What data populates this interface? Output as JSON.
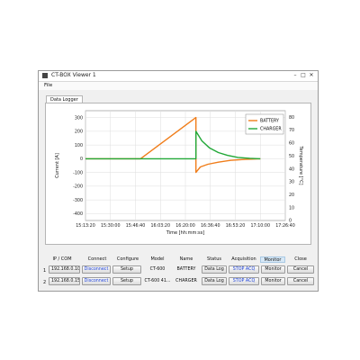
{
  "window": {
    "title": "CT-BOX Viewer 1",
    "controls": {
      "minimize": "–",
      "maximize": "□",
      "close": "✕"
    }
  },
  "menu": {
    "file": "File"
  },
  "tabs": [
    {
      "label": "Data Logger",
      "active": true
    }
  ],
  "chart_data": {
    "type": "line",
    "title": "",
    "xlabel": "Time [hh:mm:ss]",
    "ylabel_left": "Current [A]",
    "ylabel_right": "Temperature [°C]",
    "x_ticks": [
      "15:13:20",
      "15:30:00",
      "15:46:40",
      "16:03:20",
      "16:20:00",
      "16:36:40",
      "16:53:20",
      "17:10:00",
      "17:26:40"
    ],
    "y_left_ticks": [
      300,
      200,
      100,
      0,
      -100,
      -200,
      -300,
      -400
    ],
    "y_right_ticks": [
      80,
      70,
      60,
      50,
      40,
      30,
      20,
      10,
      0
    ],
    "ylim_left": [
      -450,
      350
    ],
    "ylim_right": [
      0,
      85
    ],
    "grid": true,
    "legend_position": "top-right",
    "series": [
      {
        "name": "BATTERY",
        "color": "#f07d1a",
        "points": [
          [
            "15:13:20",
            0
          ],
          [
            "15:50:00",
            0
          ],
          [
            "16:27:00",
            300
          ],
          [
            "16:27:00",
            -100
          ],
          [
            "16:30:00",
            -60
          ],
          [
            "16:35:00",
            -40
          ],
          [
            "16:42:00",
            -25
          ],
          [
            "16:50:00",
            -12
          ],
          [
            "17:00:00",
            -5
          ],
          [
            "17:10:00",
            0
          ]
        ]
      },
      {
        "name": "CHARGER",
        "color": "#22a838",
        "points": [
          [
            "15:13:20",
            0
          ],
          [
            "16:27:00",
            0
          ],
          [
            "16:27:00",
            200
          ],
          [
            "16:31:00",
            130
          ],
          [
            "16:36:00",
            80
          ],
          [
            "16:42:00",
            45
          ],
          [
            "16:48:00",
            25
          ],
          [
            "16:55:00",
            10
          ],
          [
            "17:03:00",
            3
          ],
          [
            "17:10:00",
            0
          ]
        ]
      }
    ]
  },
  "table": {
    "headers": [
      "IP / COM",
      "Connect",
      "Configure",
      "Model",
      "Name",
      "Status",
      "Acquisition",
      "Monitor",
      "Close"
    ],
    "rows": [
      {
        "index": "1",
        "ip": "192.168.0.10",
        "connect": "Disconnect",
        "configure": "Setup",
        "model": "CT-600",
        "name": "BATTERY",
        "status": "Data Log",
        "acquisition": "STOP ACQ",
        "monitor": "Monitor",
        "close": "Cancel"
      },
      {
        "index": "2",
        "ip": "192.168.0.15",
        "connect": "Disconnect",
        "configure": "Setup",
        "model": "CT-600 41...",
        "name": "CHARGER",
        "status": "Data Log",
        "acquisition": "STOP ACQ",
        "monitor": "Monitor",
        "close": "Cancel"
      }
    ]
  }
}
